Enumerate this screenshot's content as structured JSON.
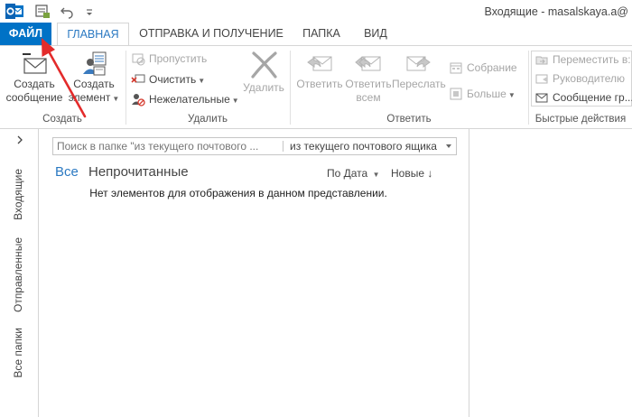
{
  "titlebar": {
    "window_title": "Входящие - masalskaya.a@"
  },
  "tabs": [
    {
      "label": "ФАЙЛ"
    },
    {
      "label": "ГЛАВНАЯ"
    },
    {
      "label": "ОТПРАВКА И ПОЛУЧЕНИЕ"
    },
    {
      "label": "ПАПКА"
    },
    {
      "label": "ВИД"
    }
  ],
  "ribbon": {
    "create": {
      "label": "Создать",
      "new_message": {
        "line1": "Создать",
        "line2": "сообщение"
      },
      "new_item": {
        "line1": "Создать",
        "line2": "элемент"
      }
    },
    "delete": {
      "label": "Удалить",
      "ignore": "Пропустить",
      "clean": "Очистить",
      "junk": "Нежелательные",
      "delete": "Удалить"
    },
    "respond": {
      "label": "Ответить",
      "reply": "Ответить",
      "reply_all": {
        "line1": "Ответить",
        "line2": "всем"
      },
      "forward": "Переслать",
      "meeting": "Собрание",
      "more": "Больше"
    },
    "quick_steps": {
      "label": "Быстрые действия",
      "items": [
        "Переместить в:",
        "Руководителю",
        "Сообщение гр..."
      ]
    }
  },
  "nav": {
    "folders": [
      "Входящие",
      "Отправленные",
      "Все папки"
    ]
  },
  "msglist": {
    "search_placeholder": "Поиск в папке \"из текущего почтового ...",
    "scope": "из текущего почтового ящика",
    "filter_all": "Все",
    "filter_unread": "Непрочитанные",
    "sort_by": "По Дата",
    "sort_order": "Новые",
    "empty_message": "Нет элементов для отображения в данном представлении."
  },
  "colors": {
    "accent": "#0072c6",
    "link": "#2b79c2",
    "annotation": "#e32b2b"
  }
}
